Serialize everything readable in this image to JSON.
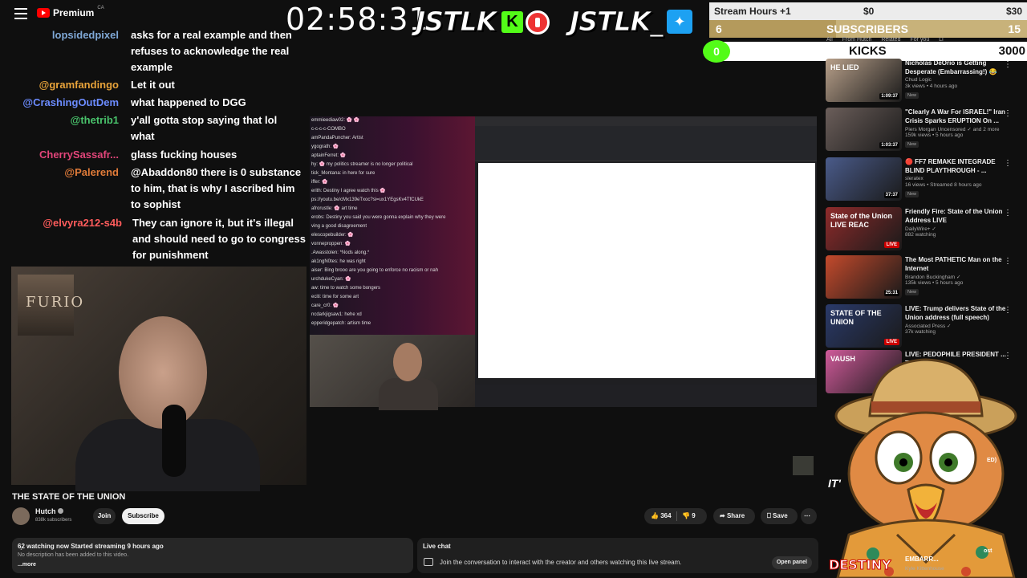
{
  "app": {
    "logo_text": "Premium",
    "region": "CA"
  },
  "overlay": {
    "timer": "02:58:31",
    "brand_left": "JSTLK",
    "kick_letter": "K",
    "brand_right": "JSTLK_",
    "goals": {
      "hours_label": "Stream Hours +1",
      "hours_current": "$0",
      "hours_target": "$30",
      "subs_current": "6",
      "subs_label": "SUBSCRIBERS",
      "subs_target": "15",
      "kicks_current": "0",
      "kicks_label": "KICKS",
      "kicks_target": "3000"
    }
  },
  "chat": [
    {
      "user": "lopsidedpixel",
      "color": "#7fa8d6",
      "text": "asks for a real example and then refuses to acknowledge the real example"
    },
    {
      "user": "@gramfandingo",
      "color": "#e8a33a",
      "text": "Let it out"
    },
    {
      "user": "@CrashingOutDem",
      "color": "#6c8cff",
      "text": "what happened to DGG"
    },
    {
      "user": "@thetrib1",
      "color": "#49c26b",
      "text": "y'all gotta stop saying that lol what"
    },
    {
      "user": "CherrySassafr...",
      "color": "#e2457a",
      "text": "glass fucking houses"
    },
    {
      "user": "@Palerend",
      "color": "#e07b39",
      "text": "@Abaddon80 there is 0 substance to him, that is why I ascribed him to sophist"
    },
    {
      "user": "@elvyra212-s4b",
      "color": "#ff5c5c",
      "text": "They can ignore it, but it's illegal and should need to go to congress for punishment"
    }
  ],
  "embedded_chat_lines": [
    "emmieediaw02: 🌸 🌸",
    "c-c-c-c-COMBO",
    "amPandaPuncher: Artist",
    "ygograth: 🌸",
    "aptainFerret: 🌸",
    "hy: 🌸 my politics streamer is no longer political",
    "tick_Montana: in here for sure",
    "iffer: 🌸",
    "erith: Destiny I agree watch this 🌸",
    "ps://youtu.be/cMx139eTxoc?si=ux1YEgsKv4TfCUkE",
    "afrorustle: 🌸 art time",
    "erobs: Destiny you said you were gonna explain why they were",
    "ving a good disagreement",
    "elescopebuilder: 🌸",
    "vonneproppen: 🌸",
    ".Awasstolen: *Nods along.*",
    "ak1ngN0tes: he was right",
    "aiser: Bing brooo are you going to enforce no racism or nah",
    "urchdukeCyan: 🌸",
    "aw: time to watch some bongers",
    "eciti: time for some art",
    "care_cr0: 🌸",
    "ncdarkjigsaw1: hehe xd",
    "epperidgepatch: artism time"
  ],
  "video": {
    "title": "THE STATE OF THE UNION",
    "channel": "Hutch",
    "subscribers": "838k subscribers",
    "join_label": "Join",
    "subscribe_label": "Subscribe",
    "likes": "364",
    "dislikes": "9",
    "share_label": "Share",
    "save_label": "Save",
    "more_label": "⋯",
    "poster_text": "FURIO"
  },
  "description": {
    "watching": "6̥2 watching now  Started streaming 9 hours ago",
    "text": "No description has been added to this video.",
    "more": "...more"
  },
  "live_chat": {
    "header": "Live chat",
    "prompt": "Join the conversation to interact with the creator and others watching this live stream.",
    "open_panel": "Open panel"
  },
  "sidebar": {
    "chips": [
      "All",
      "From Hutch",
      "Related",
      "For you",
      "Li"
    ],
    "items": [
      {
        "title": "Nicholas DeOrio is Getting Desperate (Embarrassing!) 😂",
        "channel": "Chud Logic",
        "meta": "3k views • 4 hours ago",
        "badge": "New",
        "duration": "1:09:37",
        "thumb_color": "#b8a08a",
        "thumb_text": "HE LIED"
      },
      {
        "title": "\"Clearly A War For ISRAEL!\" Iran Crisis Sparks ERUPTION On ...",
        "channel": "Piers Morgan Uncensored ✓ and 2 more",
        "meta": "159k views • 5 hours ago",
        "badge": "New",
        "duration": "1:03:37",
        "thumb_color": "#6b5e5a",
        "thumb_text": ""
      },
      {
        "title": "🔴 FF7 REMAKE INTEGRADE BLIND PLAYTHROUGH - ...",
        "channel": "sleratex",
        "meta": "16 views • Streamed 8 hours ago",
        "badge": "New",
        "duration": "37:37",
        "thumb_color": "#4a5b8a",
        "thumb_text": ""
      },
      {
        "title": "Friendly Fire: State of the Union Address LIVE",
        "channel": "DailyWire+ ✓",
        "meta": "882 watching",
        "badge": "",
        "duration": "LIVE",
        "thumb_color": "#8f2b2b",
        "thumb_text": "State of the Union  LIVE REAC"
      },
      {
        "title": "The Most PATHETIC Man on the Internet",
        "channel": "Brandon Buckingham ✓",
        "meta": "135k views • 5 hours ago",
        "badge": "New",
        "duration": "25:31",
        "thumb_color": "#c44a2c",
        "thumb_text": ""
      },
      {
        "title": "LIVE: Trump delivers State of the Union address (full speech)",
        "channel": "Associated Press ✓",
        "meta": "37k watching",
        "badge": "",
        "duration": "LIVE",
        "thumb_color": "#2a3a6a",
        "thumb_text": "STATE OF THE UNION"
      },
      {
        "title": "LIVE: PEDOPHILE PRESIDENT ... THE UNION ...",
        "channel": "",
        "meta": "",
        "badge": "",
        "duration": "",
        "thumb_color": "#d05a9a",
        "thumb_text": "VAUSH"
      }
    ],
    "bottom_partial_title": "EMBARR...",
    "bottom_partial_channel": "Kyle Kittenhouse",
    "bottom_tag": "DESTINY",
    "side_frag_1": "IT'",
    "side_frag_2": "ED)",
    "side_frag_3": "ost"
  },
  "colors": {
    "youtube_red": "#ff0000",
    "kick_green": "#53fc18",
    "goal_gold": "#c8b27a",
    "background": "#0f0f0f"
  }
}
